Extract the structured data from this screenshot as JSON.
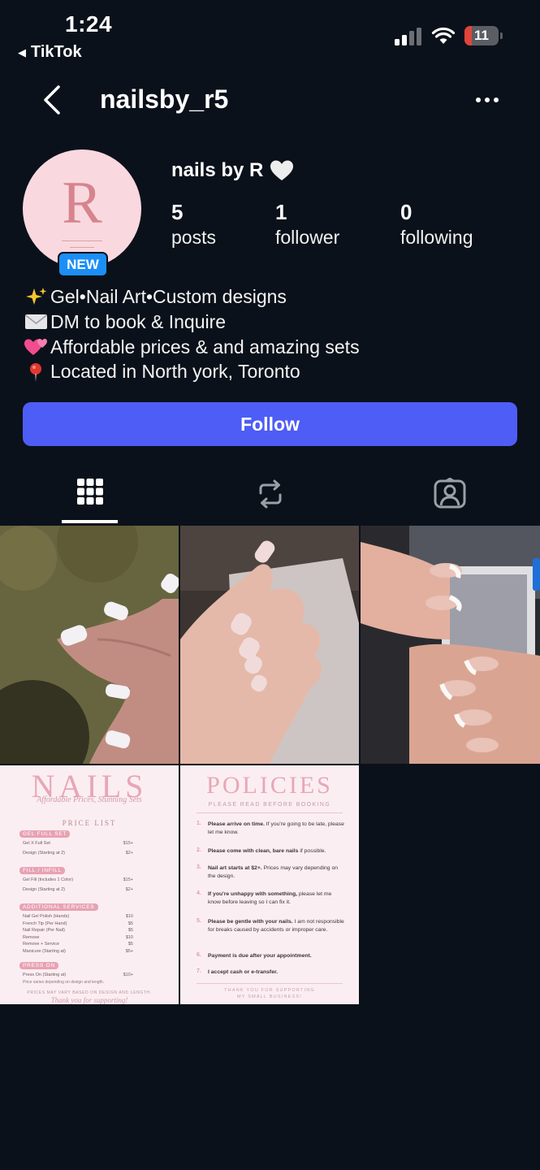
{
  "status_bar": {
    "time": "1:24",
    "back_app": "TikTok",
    "battery_level": "11",
    "icons": [
      "cellular-signal-icon",
      "wifi-icon",
      "battery-icon"
    ]
  },
  "header": {
    "username": "nailsby_r5",
    "icons": [
      "back-chevron-icon",
      "more-options-icon"
    ]
  },
  "profile": {
    "display_name": "nails by R",
    "display_name_emoji": "white-heart-icon",
    "avatar_letter": "R",
    "new_badge": "NEW",
    "stats": [
      {
        "value": "5",
        "label": "posts"
      },
      {
        "value": "1",
        "label": "follower"
      },
      {
        "value": "0",
        "label": "following"
      }
    ],
    "bio": [
      {
        "emoji": "sparkles-icon",
        "text": "Gel•Nail Art•Custom designs"
      },
      {
        "emoji": "envelope-icon",
        "text": "DM to book & Inquire"
      },
      {
        "emoji": "two-hearts-icon",
        "text": "Affordable prices & and amazing sets"
      },
      {
        "emoji": "pin-icon",
        "text": "Located in North york, Toronto"
      }
    ]
  },
  "follow_button": "Follow",
  "tabs": [
    {
      "icon": "grid-icon",
      "active": true
    },
    {
      "icon": "repost-icon",
      "active": false
    },
    {
      "icon": "tagged-icon",
      "active": false
    }
  ],
  "posts": {
    "count": 5,
    "price_list": {
      "title": "NAILS",
      "subtitle": "Affordable Prices, Stunning Sets",
      "heading": "PRICE LIST",
      "sections": [
        {
          "name": "GEL FULL SET",
          "items": [
            [
              "Gel X Full Set",
              "$15+"
            ],
            [
              "Design (Starting at 2)",
              "$2+"
            ]
          ]
        },
        {
          "name": "FILL / INFILL",
          "items": [
            [
              "Gel Fill (Includes 1 Color)",
              "$15+"
            ],
            [
              "Design (Starting at 2)",
              "$2+"
            ]
          ]
        },
        {
          "name": "ADDITIONAL SERVICES",
          "items": [
            [
              "Nail Gel Polish (Hands)",
              "$10"
            ],
            [
              "French Tip (Per Hand)",
              "$5"
            ],
            [
              "Nail Repair (Per Nail)",
              "$5"
            ],
            [
              "Remove",
              "$10"
            ],
            [
              "Remove + Service",
              "$5"
            ],
            [
              "Manicure (Starting at)",
              "$5+"
            ]
          ]
        },
        {
          "name": "PRESS ON",
          "items": [
            [
              "Press On (Starting at)",
              "$10+"
            ]
          ]
        }
      ],
      "press_on_note": "Price varies depending on design and length.",
      "footer": "PRICES MAY VARY BASED ON DESIGN AND LENGTH.",
      "thanks": "Thank you for supporting!"
    },
    "policies": {
      "title": "POLICIES",
      "subtitle": "PLEASE READ BEFORE BOOKING",
      "items": [
        {
          "n": "1.",
          "bold": "Please arrive on time.",
          "rest": " If you're going to be late, please let me know."
        },
        {
          "n": "2.",
          "bold": "Please come with clean, bare nails",
          "rest": " if possible."
        },
        {
          "n": "3.",
          "bold": "Nail art starts at $2+.",
          "rest": " Prices may vary depending on the design."
        },
        {
          "n": "4.",
          "bold": "If you're unhappy with something,",
          "rest": " please let me know before leaving so I can fix it."
        },
        {
          "n": "5.",
          "bold": "Please be gentle with your nails.",
          "rest": " I am not responsible for breaks caused by accidents or improper care."
        },
        {
          "n": "6.",
          "bold": "Payment is due after your appointment.",
          "rest": ""
        },
        {
          "n": "7.",
          "bold": "I accept cash or e-transfer.",
          "rest": ""
        }
      ],
      "footer_1": "THANK YOU FOR SUPPORTING",
      "footer_2": "MY SMALL BUSINESS!"
    }
  }
}
